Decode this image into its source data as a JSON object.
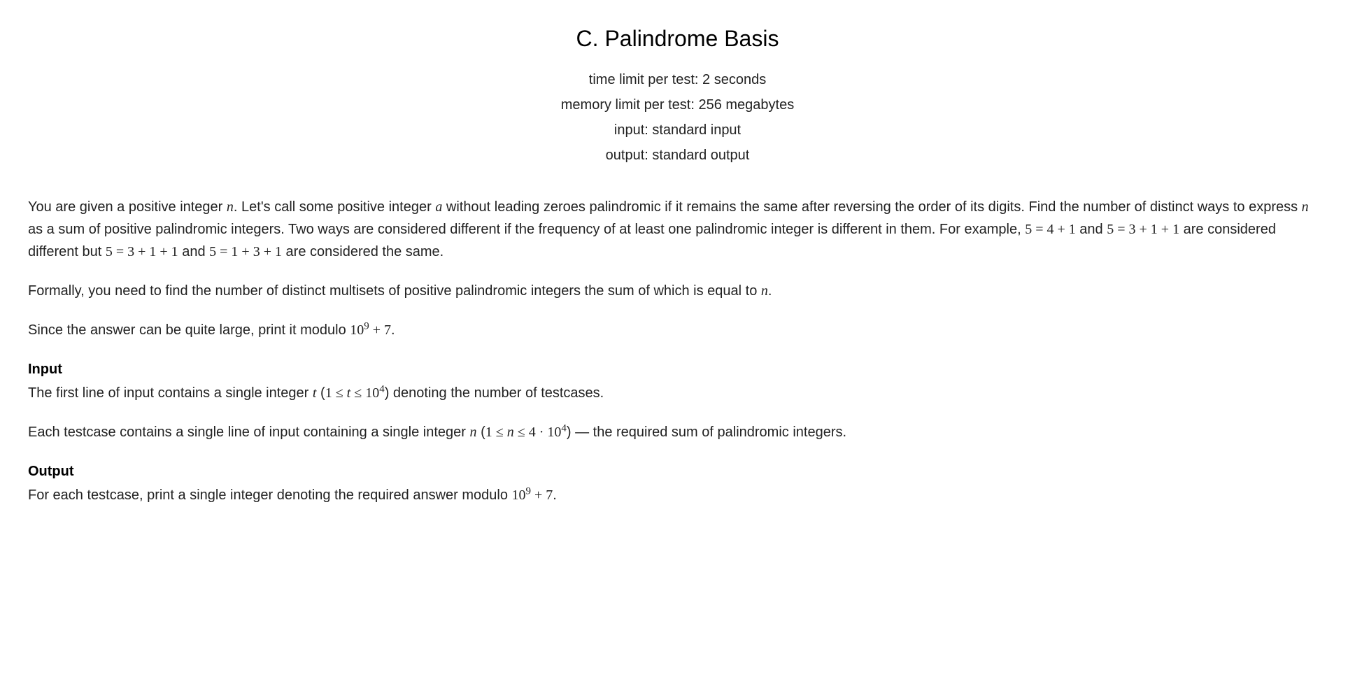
{
  "header": {
    "title": "C. Palindrome Basis",
    "time_limit": "time limit per test: 2 seconds",
    "memory_limit": "memory limit per test: 256 megabytes",
    "input": "input: standard input",
    "output": "output: standard output"
  },
  "body": {
    "p1_part1": "You are given a positive integer ",
    "p1_var_n": "n",
    "p1_part2": ". Let's call some positive integer ",
    "p1_var_a": "a",
    "p1_part3": " without leading zeroes palindromic if it remains the same after reversing the order of its digits. Find the number of distinct ways to express ",
    "p1_var_n2": "n",
    "p1_part4": " as a sum of positive palindromic integers. Two ways are considered different if the frequency of at least one palindromic integer is different in them. For example, ",
    "p1_eq1": "5 = 4 + 1",
    "p1_part5": " and ",
    "p1_eq2": "5 = 3 + 1 + 1",
    "p1_part6": " are considered different but ",
    "p1_eq3": "5 = 3 + 1 + 1",
    "p1_part7": " and ",
    "p1_eq4": "5 = 1 + 3 + 1",
    "p1_part8": " are considered the same.",
    "p2_part1": "Formally, you need to find the number of distinct multisets of positive palindromic integers the sum of which is equal to ",
    "p2_var_n": "n",
    "p2_part2": ".",
    "p3_part1": "Since the answer can be quite large, print it modulo ",
    "p3_mod_base": "10",
    "p3_mod_exp": "9",
    "p3_mod_tail": " + 7",
    "p3_part2": ".",
    "input_title": "Input",
    "input_p1_part1": "The first line of input contains a single integer ",
    "input_p1_var_t": "t",
    "input_p1_part2": " (",
    "input_p1_range_a": "1 ≤ ",
    "input_p1_range_t": "t",
    "input_p1_range_b": " ≤ 10",
    "input_p1_range_exp": "4",
    "input_p1_part3": ") denoting the number of testcases.",
    "input_p2_part1": "Each testcase contains a single line of input containing a single integer ",
    "input_p2_var_n": "n",
    "input_p2_part2": " (",
    "input_p2_range_a": "1 ≤ ",
    "input_p2_range_n": "n",
    "input_p2_range_b": " ≤ 4 · 10",
    "input_p2_range_exp": "4",
    "input_p2_part3": ") — the required sum of palindromic integers.",
    "output_title": "Output",
    "output_p1_part1": "For each testcase, print a single integer denoting the required answer modulo ",
    "output_p1_mod_base": "10",
    "output_p1_mod_exp": "9",
    "output_p1_mod_tail": " + 7",
    "output_p1_part2": "."
  }
}
